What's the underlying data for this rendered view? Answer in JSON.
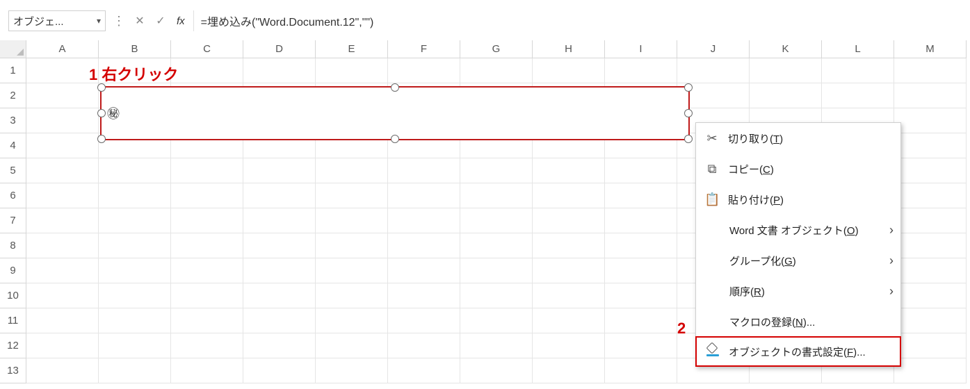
{
  "formula_bar": {
    "name_box": "オブジェ...",
    "cancel": "✕",
    "enter": "✓",
    "fx": "fx",
    "formula": "=埋め込み(\"Word.Document.12\",\"\")"
  },
  "columns": [
    "A",
    "B",
    "C",
    "D",
    "E",
    "F",
    "G",
    "H",
    "I",
    "J",
    "K",
    "L",
    "M"
  ],
  "rows": [
    "1",
    "2",
    "3",
    "4",
    "5",
    "6",
    "7",
    "8",
    "9",
    "10",
    "11",
    "12",
    "13"
  ],
  "embed_symbol": "㊙",
  "annotations": {
    "one": "1 右クリック",
    "two": "2"
  },
  "menu": {
    "cut": {
      "pre": "切り取り(",
      "u": "T",
      "post": ")"
    },
    "copy": {
      "pre": "コピー(",
      "u": "C",
      "post": ")"
    },
    "paste": {
      "pre": "貼り付け(",
      "u": "P",
      "post": ")"
    },
    "wordobj": {
      "pre": "Word 文書 オブジェクト(",
      "u": "O",
      "post": ")"
    },
    "group": {
      "pre": "グループ化(",
      "u": "G",
      "post": ")"
    },
    "order": {
      "pre": "順序(",
      "u": "R",
      "post": ")"
    },
    "macro": {
      "pre": "マクロの登録(",
      "u": "N",
      "post": ")..."
    },
    "format": {
      "pre": "オブジェクトの書式設定(",
      "u": "F",
      "post": ")..."
    }
  }
}
